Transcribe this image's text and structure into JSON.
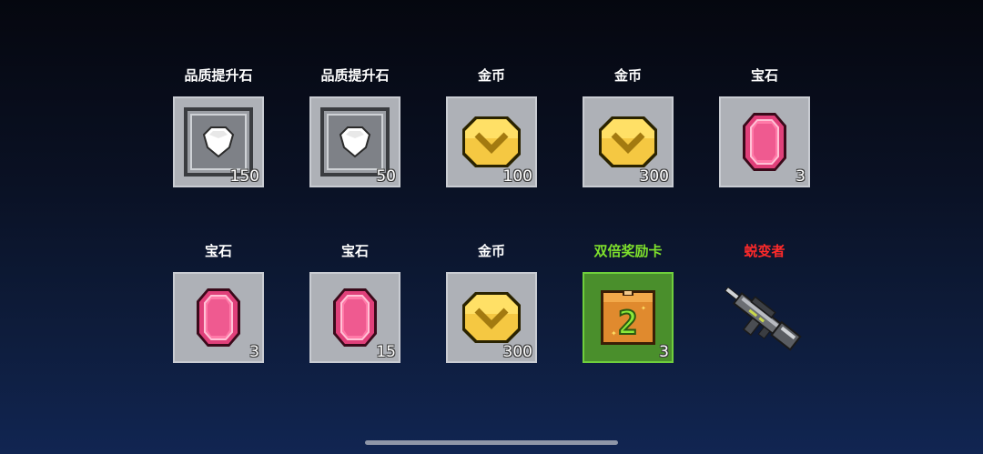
{
  "rewards": [
    {
      "name": "品质提升石",
      "qty": "150",
      "icon": "quality-stone-icon",
      "name_color": "#ffffff"
    },
    {
      "name": "品质提升石",
      "qty": "50",
      "icon": "quality-stone-icon",
      "name_color": "#ffffff"
    },
    {
      "name": "金币",
      "qty": "100",
      "icon": "gold-coin-icon",
      "name_color": "#ffffff"
    },
    {
      "name": "金币",
      "qty": "300",
      "icon": "gold-coin-icon",
      "name_color": "#ffffff"
    },
    {
      "name": "宝石",
      "qty": "3",
      "icon": "pink-gem-icon",
      "name_color": "#ffffff"
    },
    {
      "name": "宝石",
      "qty": "3",
      "icon": "pink-gem-icon",
      "name_color": "#ffffff"
    },
    {
      "name": "宝石",
      "qty": "15",
      "icon": "pink-gem-icon",
      "name_color": "#ffffff"
    },
    {
      "name": "金币",
      "qty": "300",
      "icon": "gold-coin-icon",
      "name_color": "#ffffff"
    },
    {
      "name": "双倍奖励卡",
      "qty": "3",
      "icon": "double-reward-card-icon",
      "name_color": "#7ee02c"
    },
    {
      "name": "蜕变者",
      "qty": "",
      "icon": "rifle-weapon-icon",
      "name_color": "#ff2a2a"
    }
  ],
  "colors": {
    "slot_bg": "#aeb1b7",
    "card_slot_bg": "#4a8f2c",
    "highlight_green": "#7ee02c",
    "weapon_red": "#ff2a2a"
  }
}
